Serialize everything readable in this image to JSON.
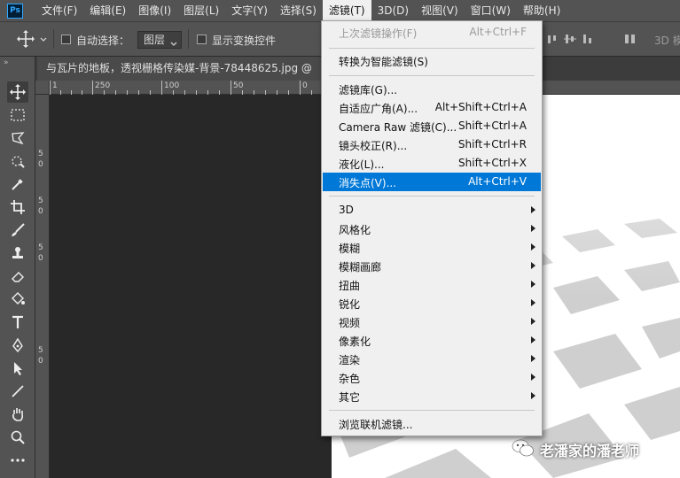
{
  "app": {
    "logo": "Ps"
  },
  "menubar": {
    "items": [
      "文件(F)",
      "编辑(E)",
      "图像(I)",
      "图层(L)",
      "文字(Y)",
      "选择(S)",
      "滤镜(T)",
      "3D(D)",
      "视图(V)",
      "窗口(W)",
      "帮助(H)"
    ],
    "active_index": 6
  },
  "options": {
    "auto_select_label": "自动选择：",
    "layer_value": "图层",
    "show_transform_label": "显示变换控件",
    "right_label": "3D 模"
  },
  "document": {
    "tab_title": "与瓦片的地板，透视栅格传染媒-背景-78448625.jpg @"
  },
  "rulers": {
    "top_labels": [
      "1",
      "250",
      "100",
      "50",
      "0"
    ],
    "left_labels": [
      "5",
      "0",
      "5",
      "0",
      "5",
      "0",
      "5",
      "0"
    ]
  },
  "filter_menu": {
    "last_filter": {
      "label": "上次滤镜操作(F)",
      "shortcut": "Alt+Ctrl+F"
    },
    "smart_filters": {
      "label": "转换为智能滤镜(S)"
    },
    "filters": [
      {
        "label": "滤镜库(G)...",
        "shortcut": ""
      },
      {
        "label": "自适应广角(A)...",
        "shortcut": "Alt+Shift+Ctrl+A"
      },
      {
        "label": "Camera Raw 滤镜(C)...",
        "shortcut": "Shift+Ctrl+A"
      },
      {
        "label": "镜头校正(R)...",
        "shortcut": "Shift+Ctrl+R"
      },
      {
        "label": "液化(L)...",
        "shortcut": "Shift+Ctrl+X"
      },
      {
        "label": "消失点(V)...",
        "shortcut": "Alt+Ctrl+V"
      }
    ],
    "highlighted_index": 5,
    "submenus": [
      "3D",
      "风格化",
      "模糊",
      "模糊画廊",
      "扭曲",
      "锐化",
      "视频",
      "像素化",
      "渲染",
      "杂色",
      "其它"
    ],
    "browse": {
      "label": "浏览联机滤镜..."
    }
  },
  "watermark": {
    "text": "老潘家的潘老师"
  },
  "colors": {
    "highlight": "#0078d7",
    "panel": "#535353",
    "canvas": "#282828"
  }
}
